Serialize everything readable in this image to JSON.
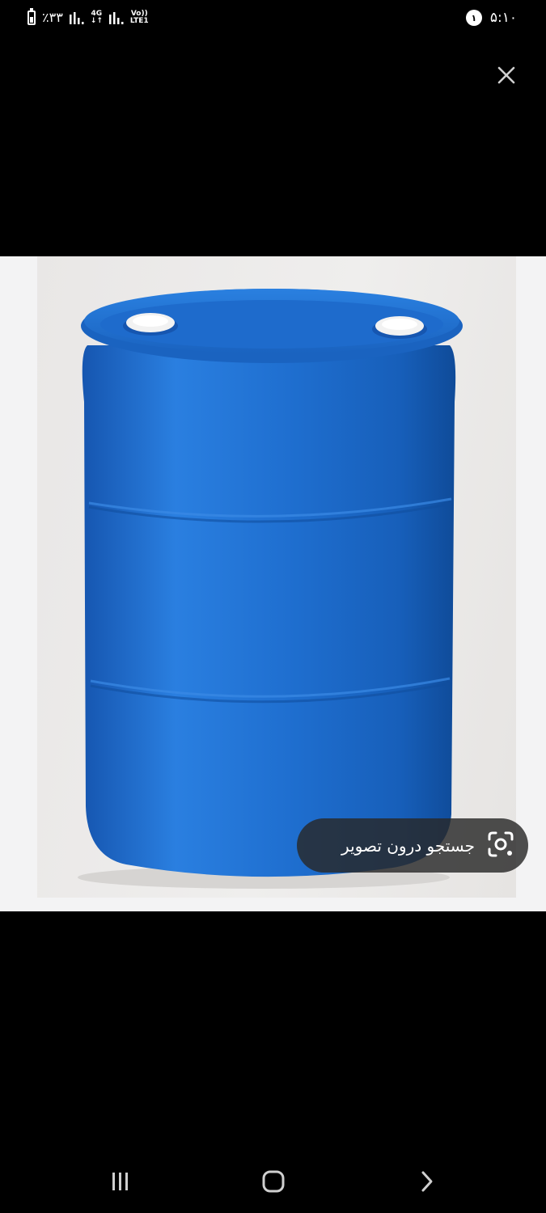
{
  "status_bar": {
    "battery_percent": "٪۳۳",
    "network_type": "4G",
    "volte_label_top": "Vo))",
    "volte_label_bottom": "LTE1",
    "notification_count": "۱",
    "time": "۵:۱۰"
  },
  "icons": {
    "close": "close-icon",
    "lens": "lens-camera-icon",
    "recents": "recents-icon",
    "home": "home-icon",
    "back": "back-icon"
  },
  "image_viewer": {
    "lens_button_label": "جستجو درون تصویر"
  },
  "colors": {
    "barrel_blue": "#1f6fd0",
    "cap_white": "#f2f2f2",
    "pill_bg": "#282828"
  }
}
